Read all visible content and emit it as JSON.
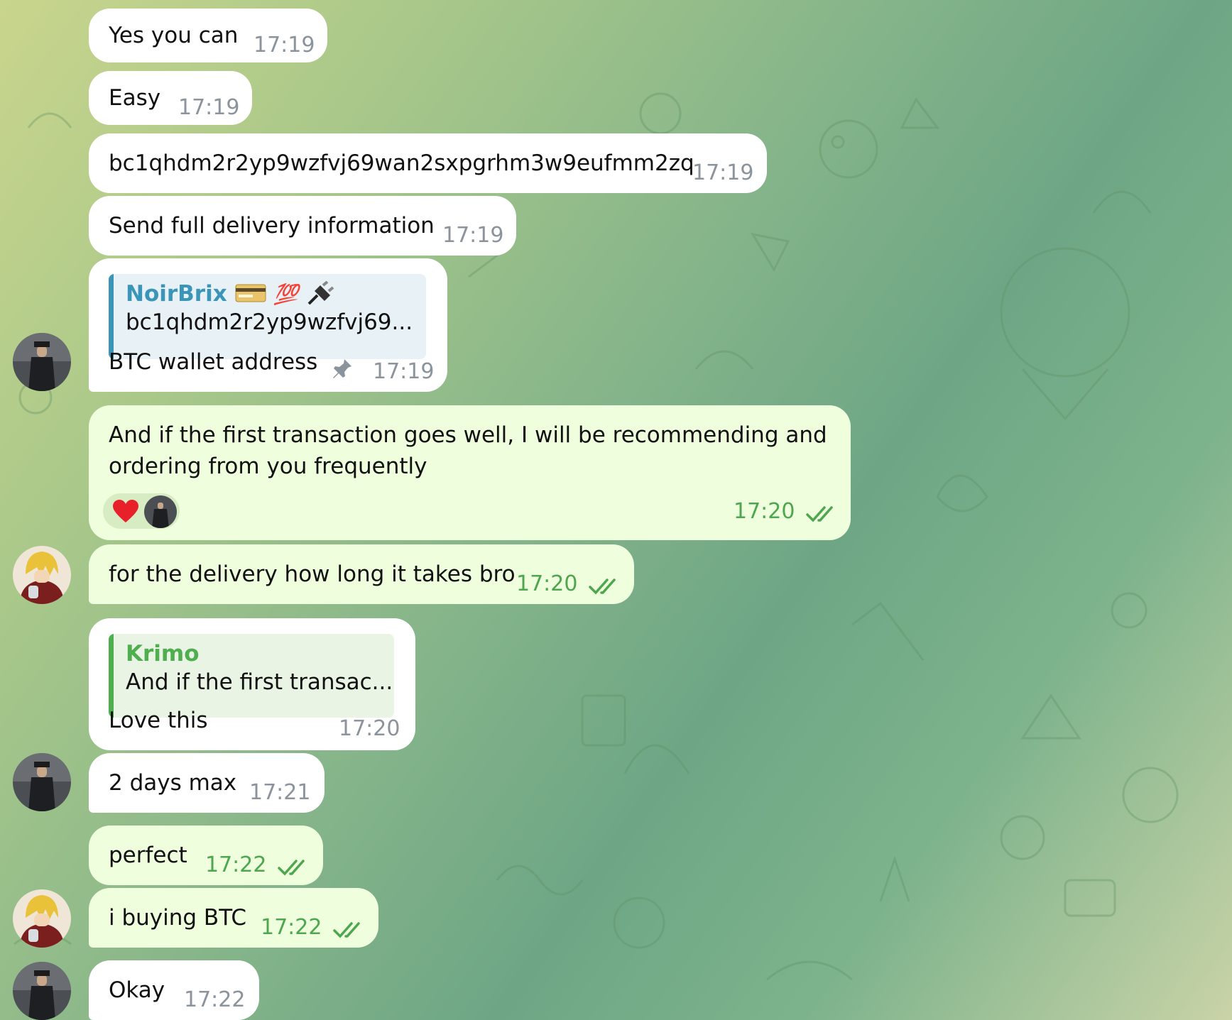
{
  "messages": [
    {
      "text": "Yes you can",
      "time": "17:19"
    },
    {
      "text": "Easy",
      "time": "17:19"
    },
    {
      "text": "bc1qhdm2r2yp9wzfvj69wan2sxpgrhm3w9eufmm2zq",
      "time": "17:19"
    },
    {
      "text": "Send full delivery information",
      "time": "17:19"
    },
    {
      "reply": {
        "name": "NoirBrix",
        "name_emoji": "💯",
        "text": "bc1qhdm2r2yp9wzfvj69..."
      },
      "text": "BTC wallet address",
      "time": "17:19",
      "pinned": true
    },
    {
      "text_line1": "And if the first transaction goes well, I will be recommending and",
      "text_line2": "ordering from you frequently",
      "time": "17:20",
      "reaction": "❤️",
      "read": true
    },
    {
      "text": "for the delivery how long it takes bro",
      "time": "17:20",
      "read": true
    },
    {
      "reply": {
        "name": "Krimo",
        "text": "And if the first transac..."
      },
      "text": "Love this",
      "time": "17:20"
    },
    {
      "text": "2 days max",
      "time": "17:21"
    },
    {
      "text": "perfect",
      "time": "17:22",
      "read": true
    },
    {
      "text": "i buying BTC",
      "time": "17:22",
      "read": true
    },
    {
      "text": "Okay",
      "time": "17:22"
    }
  ],
  "colors": {
    "incoming_bubble": "#ffffff",
    "outgoing_bubble": "#effedd",
    "outgoing_time": "#4ea64f",
    "incoming_time": "#8b949c",
    "reply_accent_noirbrix": "#3a95b8",
    "reply_accent_krimo": "#4fae4e"
  },
  "icons": [
    "pin-icon",
    "double-check-icon",
    "card-emoji",
    "plug-emoji",
    "heart-reaction"
  ]
}
